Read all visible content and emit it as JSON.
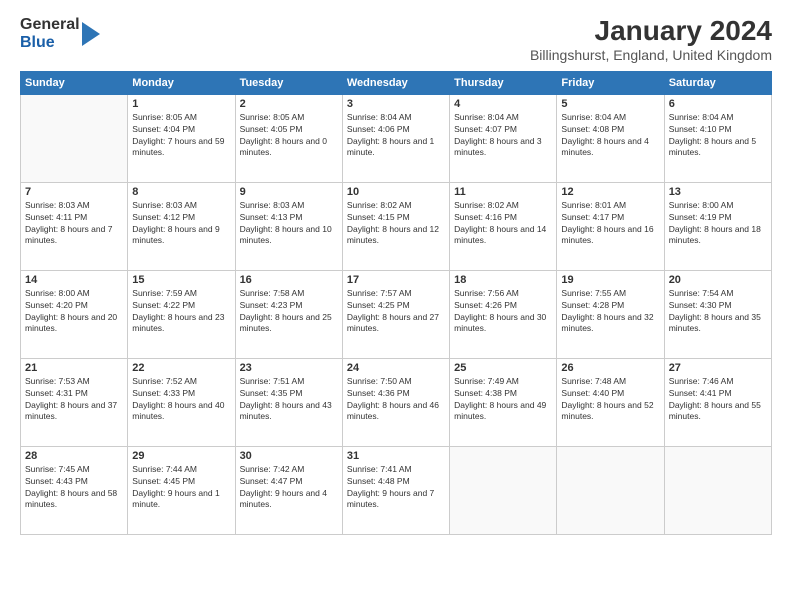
{
  "logo": {
    "general": "General",
    "blue": "Blue"
  },
  "title": "January 2024",
  "location": "Billingshurst, England, United Kingdom",
  "weekdays": [
    "Sunday",
    "Monday",
    "Tuesday",
    "Wednesday",
    "Thursday",
    "Friday",
    "Saturday"
  ],
  "weeks": [
    [
      {
        "day": "",
        "sunrise": "",
        "sunset": "",
        "daylight": ""
      },
      {
        "day": "1",
        "sunrise": "Sunrise: 8:05 AM",
        "sunset": "Sunset: 4:04 PM",
        "daylight": "Daylight: 7 hours and 59 minutes."
      },
      {
        "day": "2",
        "sunrise": "Sunrise: 8:05 AM",
        "sunset": "Sunset: 4:05 PM",
        "daylight": "Daylight: 8 hours and 0 minutes."
      },
      {
        "day": "3",
        "sunrise": "Sunrise: 8:04 AM",
        "sunset": "Sunset: 4:06 PM",
        "daylight": "Daylight: 8 hours and 1 minute."
      },
      {
        "day": "4",
        "sunrise": "Sunrise: 8:04 AM",
        "sunset": "Sunset: 4:07 PM",
        "daylight": "Daylight: 8 hours and 3 minutes."
      },
      {
        "day": "5",
        "sunrise": "Sunrise: 8:04 AM",
        "sunset": "Sunset: 4:08 PM",
        "daylight": "Daylight: 8 hours and 4 minutes."
      },
      {
        "day": "6",
        "sunrise": "Sunrise: 8:04 AM",
        "sunset": "Sunset: 4:10 PM",
        "daylight": "Daylight: 8 hours and 5 minutes."
      }
    ],
    [
      {
        "day": "7",
        "sunrise": "Sunrise: 8:03 AM",
        "sunset": "Sunset: 4:11 PM",
        "daylight": "Daylight: 8 hours and 7 minutes."
      },
      {
        "day": "8",
        "sunrise": "Sunrise: 8:03 AM",
        "sunset": "Sunset: 4:12 PM",
        "daylight": "Daylight: 8 hours and 9 minutes."
      },
      {
        "day": "9",
        "sunrise": "Sunrise: 8:03 AM",
        "sunset": "Sunset: 4:13 PM",
        "daylight": "Daylight: 8 hours and 10 minutes."
      },
      {
        "day": "10",
        "sunrise": "Sunrise: 8:02 AM",
        "sunset": "Sunset: 4:15 PM",
        "daylight": "Daylight: 8 hours and 12 minutes."
      },
      {
        "day": "11",
        "sunrise": "Sunrise: 8:02 AM",
        "sunset": "Sunset: 4:16 PM",
        "daylight": "Daylight: 8 hours and 14 minutes."
      },
      {
        "day": "12",
        "sunrise": "Sunrise: 8:01 AM",
        "sunset": "Sunset: 4:17 PM",
        "daylight": "Daylight: 8 hours and 16 minutes."
      },
      {
        "day": "13",
        "sunrise": "Sunrise: 8:00 AM",
        "sunset": "Sunset: 4:19 PM",
        "daylight": "Daylight: 8 hours and 18 minutes."
      }
    ],
    [
      {
        "day": "14",
        "sunrise": "Sunrise: 8:00 AM",
        "sunset": "Sunset: 4:20 PM",
        "daylight": "Daylight: 8 hours and 20 minutes."
      },
      {
        "day": "15",
        "sunrise": "Sunrise: 7:59 AM",
        "sunset": "Sunset: 4:22 PM",
        "daylight": "Daylight: 8 hours and 23 minutes."
      },
      {
        "day": "16",
        "sunrise": "Sunrise: 7:58 AM",
        "sunset": "Sunset: 4:23 PM",
        "daylight": "Daylight: 8 hours and 25 minutes."
      },
      {
        "day": "17",
        "sunrise": "Sunrise: 7:57 AM",
        "sunset": "Sunset: 4:25 PM",
        "daylight": "Daylight: 8 hours and 27 minutes."
      },
      {
        "day": "18",
        "sunrise": "Sunrise: 7:56 AM",
        "sunset": "Sunset: 4:26 PM",
        "daylight": "Daylight: 8 hours and 30 minutes."
      },
      {
        "day": "19",
        "sunrise": "Sunrise: 7:55 AM",
        "sunset": "Sunset: 4:28 PM",
        "daylight": "Daylight: 8 hours and 32 minutes."
      },
      {
        "day": "20",
        "sunrise": "Sunrise: 7:54 AM",
        "sunset": "Sunset: 4:30 PM",
        "daylight": "Daylight: 8 hours and 35 minutes."
      }
    ],
    [
      {
        "day": "21",
        "sunrise": "Sunrise: 7:53 AM",
        "sunset": "Sunset: 4:31 PM",
        "daylight": "Daylight: 8 hours and 37 minutes."
      },
      {
        "day": "22",
        "sunrise": "Sunrise: 7:52 AM",
        "sunset": "Sunset: 4:33 PM",
        "daylight": "Daylight: 8 hours and 40 minutes."
      },
      {
        "day": "23",
        "sunrise": "Sunrise: 7:51 AM",
        "sunset": "Sunset: 4:35 PM",
        "daylight": "Daylight: 8 hours and 43 minutes."
      },
      {
        "day": "24",
        "sunrise": "Sunrise: 7:50 AM",
        "sunset": "Sunset: 4:36 PM",
        "daylight": "Daylight: 8 hours and 46 minutes."
      },
      {
        "day": "25",
        "sunrise": "Sunrise: 7:49 AM",
        "sunset": "Sunset: 4:38 PM",
        "daylight": "Daylight: 8 hours and 49 minutes."
      },
      {
        "day": "26",
        "sunrise": "Sunrise: 7:48 AM",
        "sunset": "Sunset: 4:40 PM",
        "daylight": "Daylight: 8 hours and 52 minutes."
      },
      {
        "day": "27",
        "sunrise": "Sunrise: 7:46 AM",
        "sunset": "Sunset: 4:41 PM",
        "daylight": "Daylight: 8 hours and 55 minutes."
      }
    ],
    [
      {
        "day": "28",
        "sunrise": "Sunrise: 7:45 AM",
        "sunset": "Sunset: 4:43 PM",
        "daylight": "Daylight: 8 hours and 58 minutes."
      },
      {
        "day": "29",
        "sunrise": "Sunrise: 7:44 AM",
        "sunset": "Sunset: 4:45 PM",
        "daylight": "Daylight: 9 hours and 1 minute."
      },
      {
        "day": "30",
        "sunrise": "Sunrise: 7:42 AM",
        "sunset": "Sunset: 4:47 PM",
        "daylight": "Daylight: 9 hours and 4 minutes."
      },
      {
        "day": "31",
        "sunrise": "Sunrise: 7:41 AM",
        "sunset": "Sunset: 4:48 PM",
        "daylight": "Daylight: 9 hours and 7 minutes."
      },
      {
        "day": "",
        "sunrise": "",
        "sunset": "",
        "daylight": ""
      },
      {
        "day": "",
        "sunrise": "",
        "sunset": "",
        "daylight": ""
      },
      {
        "day": "",
        "sunrise": "",
        "sunset": "",
        "daylight": ""
      }
    ]
  ]
}
